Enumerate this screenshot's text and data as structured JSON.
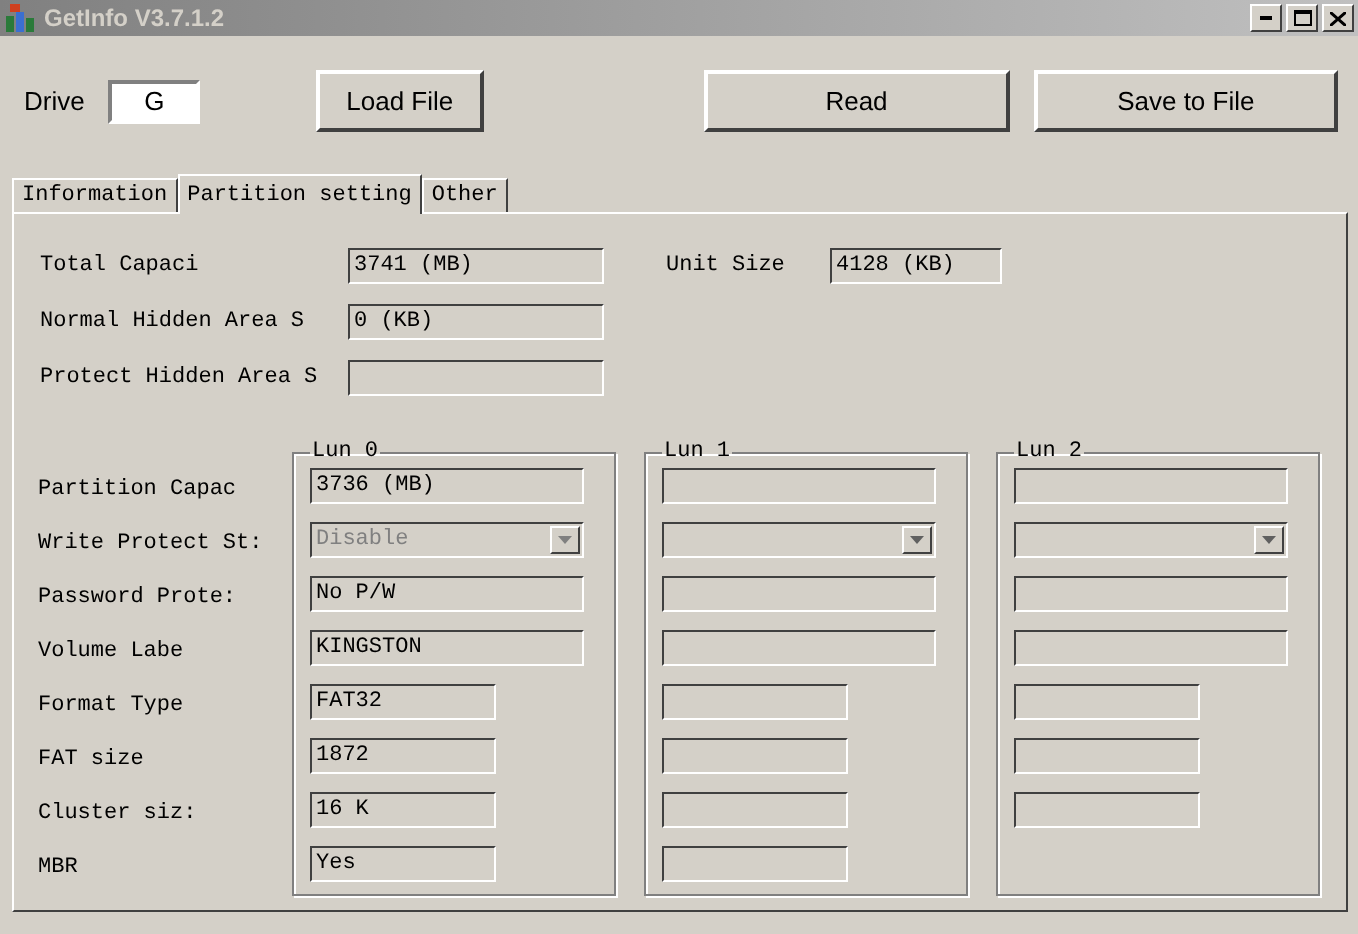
{
  "window": {
    "title": "GetInfo V3.7.1.2"
  },
  "drive": {
    "label": "Drive",
    "value": "G"
  },
  "buttons": [
    "Load File",
    "Read",
    "Save to File"
  ],
  "tabs": [
    {
      "label": "Information",
      "selected": false
    },
    {
      "label": "Partition setting",
      "selected": true
    },
    {
      "label": "Other",
      "selected": false
    }
  ],
  "summary": [
    {
      "label": "Total Capaci",
      "value": "3741  (MB)"
    },
    {
      "label": "Normal Hidden Area S",
      "value": "0  (KB)"
    },
    {
      "label": "Protect Hidden Area S"
    }
  ],
  "unit_size": {
    "label": "Unit Size",
    "value": "4128  (KB)"
  },
  "row_labels": [
    "Partition Capac",
    "Write Protect St:",
    "Password Prote:",
    "Volume Labe",
    "Format Type",
    "FAT size",
    "Cluster siz:",
    "MBR"
  ],
  "luns": [
    {
      "title": "Lun 0",
      "fields": [
        {
          "kind": "text",
          "wide": true,
          "value": "3736  (MB)"
        },
        {
          "kind": "combo",
          "wide": true,
          "disabled": true,
          "value": "Disable"
        },
        {
          "kind": "text",
          "wide": true,
          "value": "No P/W"
        },
        {
          "kind": "text",
          "wide": true,
          "value": "KINGSTON"
        },
        {
          "kind": "text",
          "wide": false,
          "value": "FAT32"
        },
        {
          "kind": "text",
          "wide": false,
          "value": "1872"
        },
        {
          "kind": "text",
          "wide": false,
          "value": "16 K"
        },
        {
          "kind": "text",
          "wide": false,
          "value": "Yes"
        }
      ]
    },
    {
      "title": "Lun 1",
      "fields": [
        {
          "kind": "text",
          "wide": true
        },
        {
          "kind": "combo",
          "wide": true,
          "disabled": false
        },
        {
          "kind": "text",
          "wide": true
        },
        {
          "kind": "text",
          "wide": true
        },
        {
          "kind": "text",
          "wide": false
        },
        {
          "kind": "text",
          "wide": false
        },
        {
          "kind": "text",
          "wide": false
        },
        {
          "kind": "text",
          "wide": false
        }
      ]
    },
    {
      "title": "Lun 2",
      "fields": [
        {
          "kind": "text",
          "wide": true
        },
        {
          "kind": "combo",
          "wide": true,
          "disabled": false
        },
        {
          "kind": "text",
          "wide": true
        },
        {
          "kind": "text",
          "wide": true
        },
        {
          "kind": "text",
          "wide": false
        },
        {
          "kind": "text",
          "wide": false
        },
        {
          "kind": "text",
          "wide": false
        }
      ]
    }
  ]
}
